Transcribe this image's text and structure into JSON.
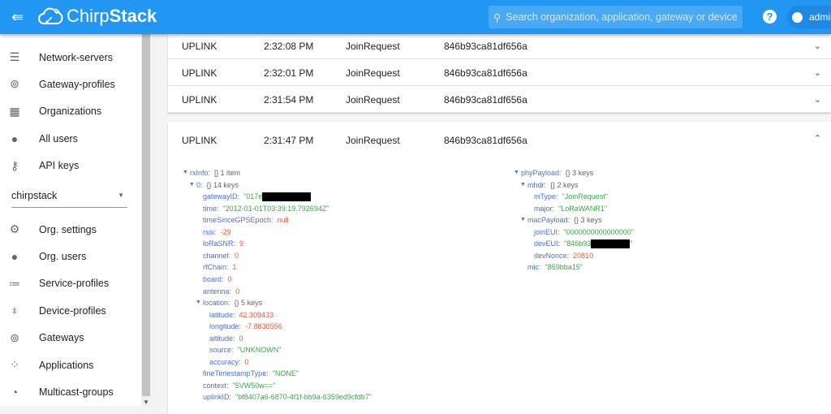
{
  "header": {
    "brand_light": "Chirp",
    "brand_bold": "Stack",
    "search_placeholder": "Search organization, application, gateway or device",
    "user": "admin",
    "accent": "#2196f3"
  },
  "sidebar": {
    "top_items": [
      {
        "label": "Network-servers",
        "icon": "server-icon"
      },
      {
        "label": "Gateway-profiles",
        "icon": "antenna-icon"
      },
      {
        "label": "Organizations",
        "icon": "building-icon"
      },
      {
        "label": "All users",
        "icon": "person-icon"
      },
      {
        "label": "API keys",
        "icon": "key-icon"
      }
    ],
    "organization": "chirpstack",
    "org_items": [
      {
        "label": "Org. settings",
        "icon": "gear-icon"
      },
      {
        "label": "Org. users",
        "icon": "person-icon"
      },
      {
        "label": "Service-profiles",
        "icon": "list-person-icon"
      },
      {
        "label": "Device-profiles",
        "icon": "sliders-icon"
      },
      {
        "label": "Gateways",
        "icon": "antenna-icon"
      },
      {
        "label": "Applications",
        "icon": "grid-icon"
      },
      {
        "label": "Multicast-groups",
        "icon": "rss-icon"
      }
    ]
  },
  "frames": [
    {
      "direction": "UPLINK",
      "time": "2:32:08 PM",
      "type": "JoinRequest",
      "devEUI": "846b93ca81df656a"
    },
    {
      "direction": "UPLINK",
      "time": "2:32:01 PM",
      "type": "JoinRequest",
      "devEUI": "846b93ca81df656a"
    },
    {
      "direction": "UPLINK",
      "time": "2:31:54 PM",
      "type": "JoinRequest",
      "devEUI": "846b93ca81df656a"
    }
  ],
  "expanded": {
    "direction": "UPLINK",
    "time": "2:31:47 PM",
    "type": "JoinRequest",
    "devEUI": "846b93ca81df656a",
    "left_tree": [
      {
        "d": 0,
        "k": "rxInfo",
        "meta": "[]  1 item",
        "open": true
      },
      {
        "d": 1,
        "k": "0",
        "meta": "{}  14 keys",
        "open": true
      },
      {
        "d": 2,
        "k": "gatewayID",
        "v": "\"017e",
        "t": "s",
        "redact": true
      },
      {
        "d": 2,
        "k": "time",
        "v": "\"2012-01-01T03:39:19.792694Z\"",
        "t": "s"
      },
      {
        "d": 2,
        "k": "timeSinceGPSEpoch",
        "v": "null",
        "t": "n"
      },
      {
        "d": 2,
        "k": "rssi",
        "v": "-29",
        "t": "n"
      },
      {
        "d": 2,
        "k": "loRaSNR",
        "v": "9",
        "t": "n"
      },
      {
        "d": 2,
        "k": "channel",
        "v": "0",
        "t": "n"
      },
      {
        "d": 2,
        "k": "rfChain",
        "v": "1",
        "t": "n"
      },
      {
        "d": 2,
        "k": "board",
        "v": "0",
        "t": "n"
      },
      {
        "d": 2,
        "k": "antenna",
        "v": "0",
        "t": "n"
      },
      {
        "d": 2,
        "k": "location",
        "meta": "{}  5 keys",
        "open": true
      },
      {
        "d": 3,
        "k": "latitude",
        "v": "42.309433",
        "t": "n"
      },
      {
        "d": 3,
        "k": "longitude",
        "v": "-7.8830556",
        "t": "n"
      },
      {
        "d": 3,
        "k": "altitude",
        "v": "0",
        "t": "n"
      },
      {
        "d": 3,
        "k": "source",
        "v": "\"UNKNOWN\"",
        "t": "s"
      },
      {
        "d": 3,
        "k": "accuracy",
        "v": "0",
        "t": "n"
      },
      {
        "d": 2,
        "k": "fineTimestampType",
        "v": "\"NONE\"",
        "t": "s"
      },
      {
        "d": 2,
        "k": "context",
        "v": "\"5VW50w==\"",
        "t": "s"
      },
      {
        "d": 2,
        "k": "uplinkID",
        "v": "\"bf8407a6-6870-4f1f-bb9a-6359ed9cfdb7\"",
        "t": "s"
      }
    ],
    "right_tree": [
      {
        "d": 0,
        "k": "phyPayload",
        "meta": "{}  3 keys",
        "open": true
      },
      {
        "d": 1,
        "k": "mhdr",
        "meta": "{}  2 keys",
        "open": true
      },
      {
        "d": 2,
        "k": "mType",
        "v": "\"JoinRequest\"",
        "t": "s"
      },
      {
        "d": 2,
        "k": "major",
        "v": "\"LoRaWANR1\"",
        "t": "s"
      },
      {
        "d": 1,
        "k": "macPayload",
        "meta": "{}  3 keys",
        "open": true
      },
      {
        "d": 2,
        "k": "joinEUI",
        "v": "\"0000000000000000\"",
        "t": "s"
      },
      {
        "d": 2,
        "k": "devEUI",
        "v": "\"846b93",
        "t": "s",
        "redact": true,
        "tail": "\""
      },
      {
        "d": 2,
        "k": "devNonce",
        "v": "20810",
        "t": "n"
      },
      {
        "d": 1,
        "k": "mic",
        "v": "\"859bba15\"",
        "t": "s"
      }
    ]
  }
}
